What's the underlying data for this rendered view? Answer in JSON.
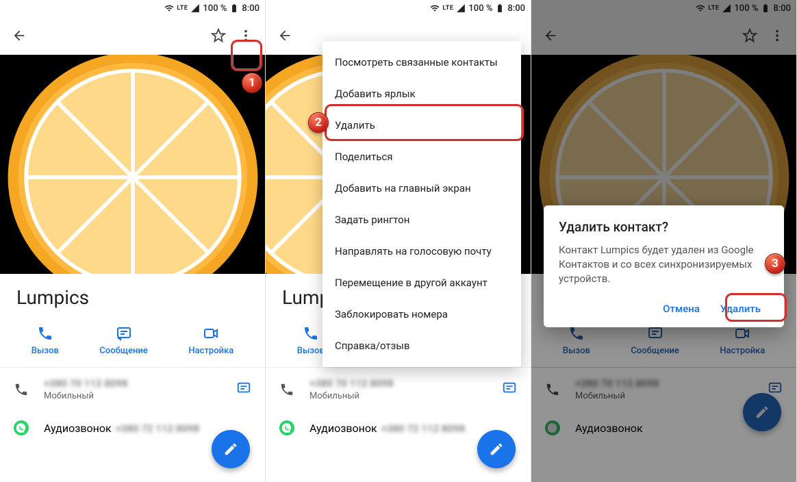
{
  "status": {
    "lte": "LTE",
    "battery_pct": "100 %",
    "time": "8:00"
  },
  "contact": {
    "name": "Lumpics",
    "phone_label": "Мобильный",
    "audiocall_label": "Аудиозвонок"
  },
  "actions": {
    "call": "Вызов",
    "message": "Сообщение",
    "video": "Настройка"
  },
  "menu": {
    "items": [
      "Посмотреть связанные контакты",
      "Добавить ярлык",
      "Удалить",
      "Поделиться",
      "Добавить на главный экран",
      "Задать рингтон",
      "Направлять на голосовую почту",
      "Перемещение в другой аккаунт",
      "Заблокировать номера",
      "Справка/отзыв"
    ]
  },
  "dialog": {
    "title": "Удалить контакт?",
    "body": "Контакт Lumpics будет удален из Google Контактов и со всех синхронизируемых устройств.",
    "cancel": "Отмена",
    "confirm": "Удалить"
  },
  "badges": {
    "b1": "1",
    "b2": "2",
    "b3": "3"
  }
}
